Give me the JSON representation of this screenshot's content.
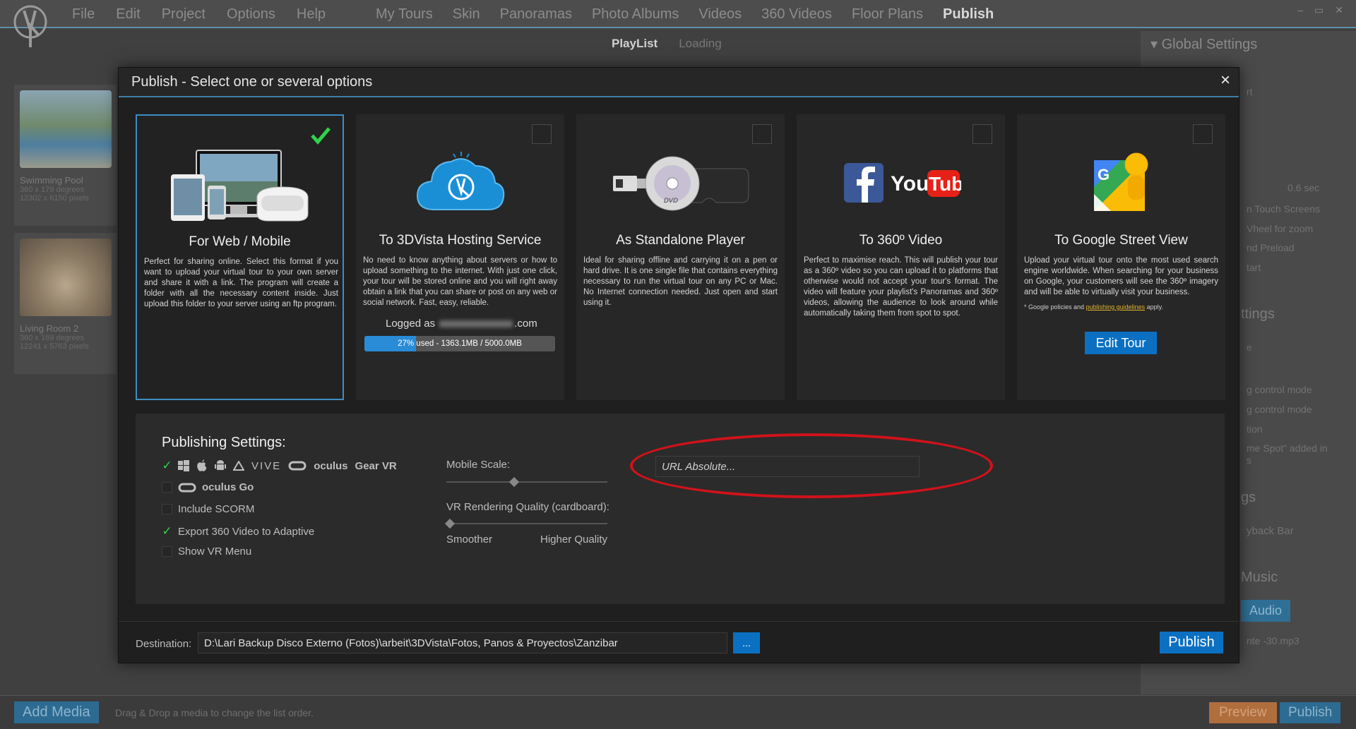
{
  "app": {
    "menu": [
      "File",
      "Edit",
      "Project",
      "Options",
      "Help"
    ],
    "topnav": [
      "My Tours",
      "Skin",
      "Panoramas",
      "Photo Albums",
      "Videos",
      "360 Videos",
      "Floor Plans",
      "Publish"
    ],
    "active_topnav": "Publish",
    "window_controls": [
      "–",
      "▭",
      "✕"
    ],
    "subtabs": [
      "PlayList",
      "Loading"
    ],
    "playlist": [
      {
        "title": "Swimming Pool",
        "line1": "360 x 179 degrees",
        "line2": "12302 x 6150 pixels"
      },
      {
        "title": "Living Room 2",
        "line1": "360 x 169 degrees",
        "line2": "12241 x 5763 pixels"
      }
    ],
    "global_settings_title": "▾ Global Settings",
    "right_panel": {
      "fragments": [
        "rt",
        "0.6 sec",
        "n Touch Screens",
        "Vheel for zoom",
        "nd Preload",
        "tart",
        "ttings",
        "e",
        "g control mode",
        "g control mode",
        "tion",
        "me Spot\" added in",
        "s",
        "gs",
        "yback Bar",
        "Music",
        "Audio",
        "nte -30.mp3"
      ]
    },
    "bottom": {
      "add_media": "Add Media",
      "drag_hint": "Drag & Drop a media to change the list order.",
      "preview": "Preview",
      "publish": "Publish"
    }
  },
  "modal": {
    "title": "Publish - Select one or several options",
    "close": "×",
    "cards": [
      {
        "title": "For Web / Mobile",
        "selected": true,
        "text": "Perfect for sharing online. Select this format if you want to upload your virtual tour to your own server and share it with a link. The program will create a folder with all the necessary content inside. Just upload this folder to your server using an ftp program."
      },
      {
        "title": "To 3DVista Hosting Service",
        "selected": false,
        "text": "No need to know anything about servers or how to upload something to the internet. With just one click, your tour will be stored online and you will right away obtain a link that you can share or post on any web or social network. Fast, easy, reliable.",
        "logged_prefix": "Logged as",
        "logged_suffix": ".com",
        "usage_label": "27% used - 1363.1MB / 5000.0MB",
        "usage_fraction": 0.27
      },
      {
        "title": "As Standalone Player",
        "selected": false,
        "text": "Ideal for sharing offline and carrying it on a pen or hard drive. It is one single file that contains everything necessary to run the virtual tour on any PC or Mac. No Internet connection needed. Just open and start using it."
      },
      {
        "title": "To 360º Video",
        "selected": false,
        "text": "Perfect to maximise reach. This will publish your tour as a 360º video so you can upload it to platforms that otherwise would not accept your tour's format. The video will feature your playlist's Panoramas and 360º videos, allowing the audience to look around while automatically taking them from spot to spot."
      },
      {
        "title": "To Google Street View",
        "selected": false,
        "text": "Upload your virtual tour onto the most used search engine worldwide. When searching for your business on Google, your customers will see the 360º imagery and will be able to virtually visit your business.",
        "note_prefix": "* Google policies and ",
        "note_link": "publishing guidelines",
        "note_suffix": " apply.",
        "button": "Edit Tour"
      }
    ],
    "settings": {
      "title": "Publishing Settings:",
      "platform_brands": [
        "VIVE",
        "oculus",
        "Gear VR"
      ],
      "oculus_go": "oculus Go",
      "options": [
        {
          "label": "Include SCORM",
          "checked": false
        },
        {
          "label": "Export 360 Video to Adaptive",
          "checked": true
        },
        {
          "label": "Show VR Menu",
          "checked": false
        }
      ],
      "mobile_scale_label": "Mobile Scale:",
      "mobile_scale_value": 0.42,
      "vr_quality_label": "VR Rendering Quality (cardboard):",
      "vr_quality_value": 0.0,
      "smoother": "Smoother",
      "higher_quality": "Higher Quality",
      "url_placeholder": "URL Absolute..."
    },
    "footer": {
      "destination_label": "Destination:",
      "destination_value": "D:\\Lari Backup Disco Externo (Fotos)\\arbeit\\3DVista\\Fotos, Panos & Proyectos\\Zanzibar",
      "browse": "...",
      "publish": "Publish"
    }
  },
  "colors": {
    "accent": "#0b70c2",
    "check": "#2fd34a",
    "annotation": "#d1121a"
  }
}
